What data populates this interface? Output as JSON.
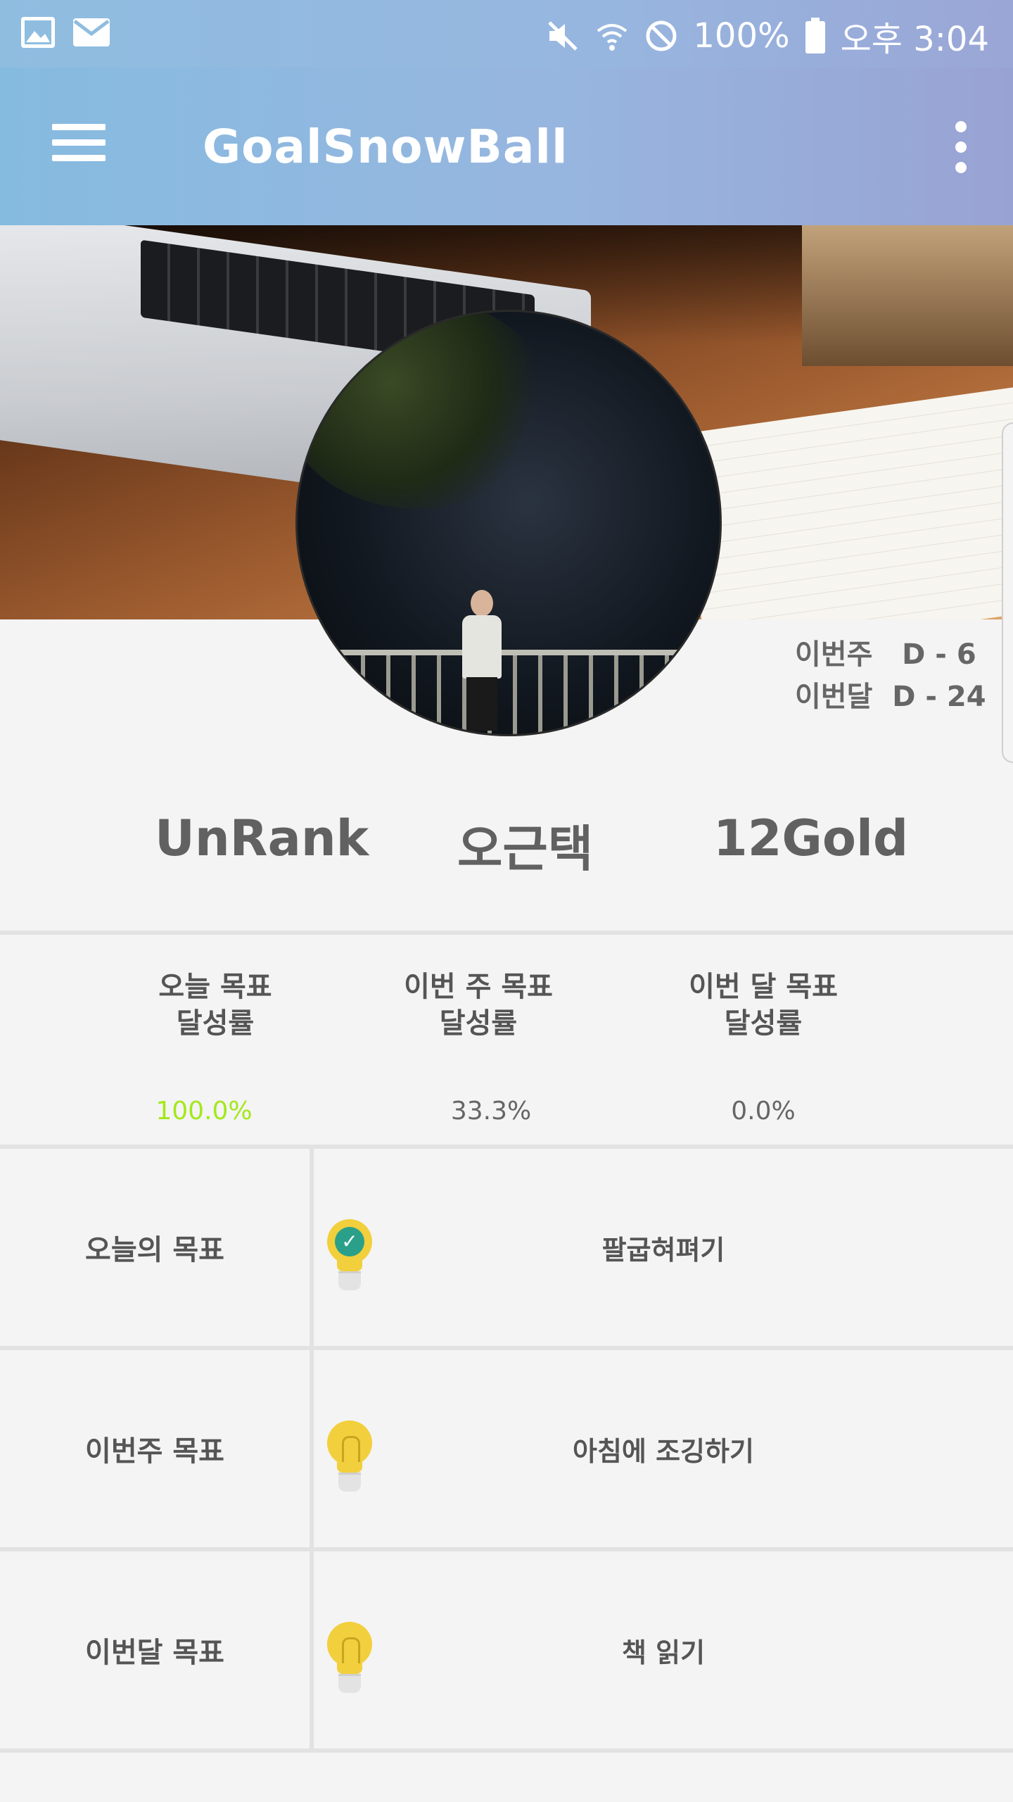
{
  "status_bar": {
    "battery": "100%",
    "time": "오후 3:04"
  },
  "app_bar": {
    "title": "GoalSnowBall"
  },
  "countdown": {
    "week": "이번주   D - 6",
    "month": "이번달  D - 24"
  },
  "profile": {
    "rank": "UnRank",
    "name": "오근택",
    "gold": "12Gold"
  },
  "rates": [
    {
      "label": "오늘 목표\n달성률",
      "value": "100.0%",
      "color": "#a4e81a"
    },
    {
      "label": "이번 주 목표\n달성률",
      "value": "33.3%",
      "color": "#666666"
    },
    {
      "label": "이번 달 목표\n달성률",
      "value": "0.0%",
      "color": "#666666"
    }
  ],
  "goals": [
    {
      "label": "오늘의 목표",
      "text": "팔굽혀펴기",
      "icon": "lightbulb-checked-icon",
      "done": true
    },
    {
      "label": "이번주 목표",
      "text": "아침에 조깅하기",
      "icon": "lightbulb-icon",
      "done": false
    },
    {
      "label": "이번달 목표",
      "text": "책 읽기",
      "icon": "lightbulb-icon",
      "done": false
    }
  ],
  "colors": {
    "app_bar_start": "#86bbe0",
    "app_bar_end": "#99a3d3",
    "background": "#f4f4f4",
    "accent_done": "#a4e81a",
    "bulb": "#f2cf3c",
    "check": "#2aa08a"
  }
}
